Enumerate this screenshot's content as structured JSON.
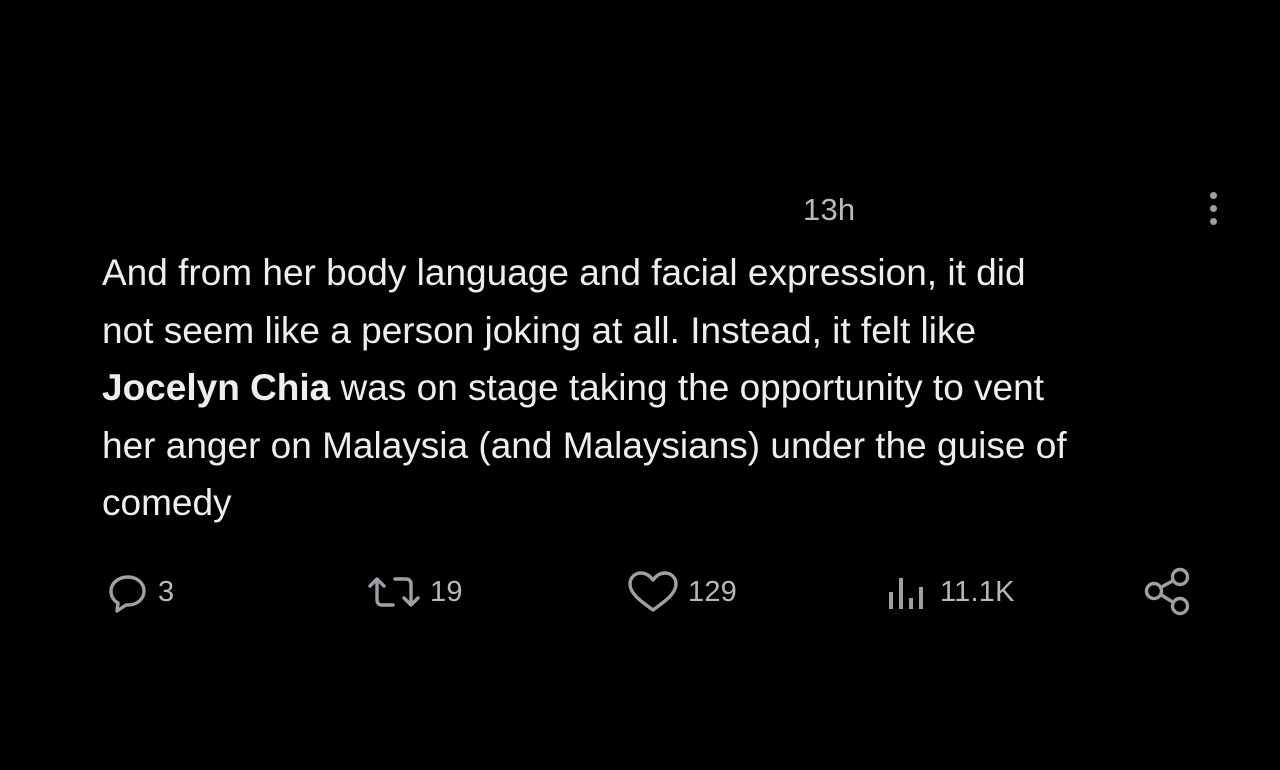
{
  "tweet": {
    "timestamp": "13h",
    "text_lines": [
      {
        "before": "And from her body language and facial expression, it did",
        "mention": "",
        "after": ""
      },
      {
        "before": "not seem like a person joking at all. Instead, it felt like",
        "mention": "",
        "after": ""
      },
      {
        "before": "",
        "mention": "Jocelyn Chia",
        "after": " was on stage taking the opportunity to vent"
      },
      {
        "before": "her anger on Malaysia (and Malaysians) under the guise of",
        "mention": "",
        "after": ""
      },
      {
        "before": "comedy",
        "mention": "",
        "after": ""
      }
    ]
  },
  "actions": {
    "reply": {
      "icon": "reply-icon",
      "count": "3"
    },
    "retweet": {
      "icon": "retweet-icon",
      "count": "19"
    },
    "like": {
      "icon": "heart-icon",
      "count": "129"
    },
    "views": {
      "icon": "analytics-icon",
      "count": "11.1K"
    },
    "share": {
      "icon": "share-icon"
    }
  },
  "colors": {
    "background": "#000000",
    "text": "#eceeef",
    "secondary": "#9ca1a6"
  }
}
